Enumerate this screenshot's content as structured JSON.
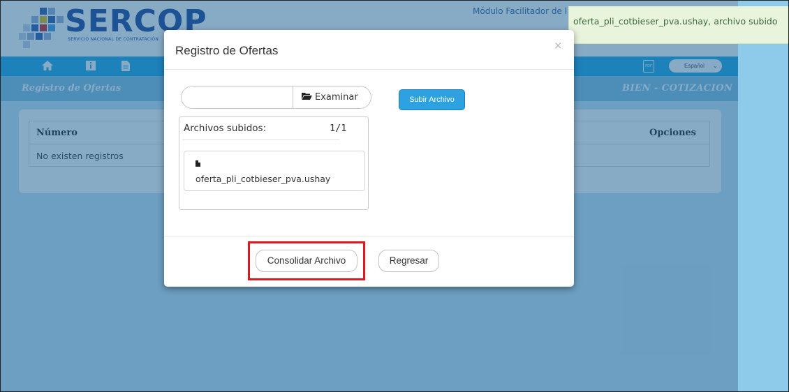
{
  "header": {
    "logo_text": "SERCOP",
    "logo_subtitle": "SERVICIO NACIONAL DE CONTRATACIÓN",
    "module_title": "Módulo Facilitador de l"
  },
  "navbar": {
    "pdf_label": "PDF",
    "language_selected": "Español",
    "icons": [
      "home-icon",
      "info-icon",
      "document-icon"
    ]
  },
  "subbar": {
    "left_title": "Registro de Ofertas",
    "right_title": "BIEN - COTIZACION"
  },
  "table": {
    "columns": [
      "Número",
      "Opciones"
    ],
    "empty_message": "No existen registros"
  },
  "toast": {
    "message": "oferta_pli_cotbieser_pva.ushay, archivo subido"
  },
  "modal": {
    "title": "Registro de Ofertas",
    "close_glyph": "×",
    "file_input_value": "",
    "browse_label": "Examinar",
    "upload_label": "Subir Archivo",
    "uploaded_header": "Archivos subidos:",
    "uploaded_count": "1/1",
    "files": [
      {
        "name": "oferta_pli_cotbieser_pva.ushay"
      }
    ],
    "consolidate_label": "Consolidar Archivo",
    "back_label": "Regresar"
  },
  "colors": {
    "navbar": "#2aaee8",
    "upload_button": "#2ea2e0",
    "highlight": "#e0171f",
    "toast_bg": "#e8f4db",
    "logo": "#2a4f9c"
  }
}
